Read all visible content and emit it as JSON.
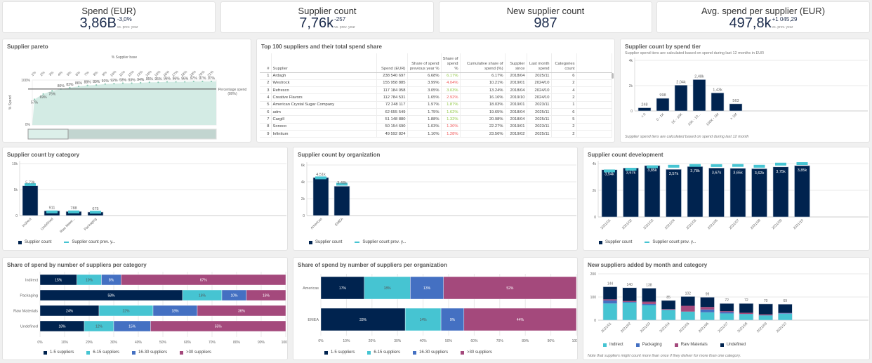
{
  "kpis": [
    {
      "title": "Spend (EUR)",
      "value": "3,86B",
      "delta": "-3,0%",
      "sub": "vs. prev. year"
    },
    {
      "title": "Supplier count",
      "value": "7,76k",
      "delta": "-257",
      "sub": "vs. prev. year"
    },
    {
      "title": "New supplier count",
      "value": "987",
      "delta": "",
      "sub": ""
    },
    {
      "title": "Avg. spend per supplier (EUR)",
      "value": "497,8k",
      "delta": "+1 045,29",
      "sub": "vs. prev. year"
    }
  ],
  "pareto": {
    "title": "Supplier pareto",
    "xtitle": "% Supplier base",
    "ytitle": "% Spend",
    "ref_label": "Percentage spend",
    "ref_value": "(80%)",
    "ref": 80,
    "x": [
      "1%",
      "2%",
      "3%",
      "4%",
      "5%",
      "6%",
      "7%",
      "8%",
      "9%",
      "10%",
      "11%",
      "12%",
      "13%",
      "14%",
      "15%",
      "16%",
      "17%",
      "18%",
      "19%",
      "20%",
      "21%"
    ],
    "y": [
      57,
      69,
      76,
      80,
      83,
      86,
      88,
      89,
      91,
      92,
      93,
      93,
      94,
      95,
      95,
      96,
      96,
      96,
      97,
      97,
      97
    ],
    "yticks": [
      "0%",
      "100%"
    ],
    "colors": {
      "fill": "#d3ebe4",
      "point": "#8cc8b4"
    }
  },
  "table": {
    "title": "Top 100 suppliers and their total spend share",
    "columns": [
      "#",
      "Supplier",
      "Spend (EUR)",
      "Share of spend previous year %",
      "Share of spend %",
      "Cumulative share of spend (%)",
      "Supplier since",
      "Last month spend",
      "Categories count"
    ],
    "rows": [
      [
        "1",
        "Ardagh",
        "238 540 697",
        "6.68%",
        "6.17%",
        "6.17%",
        "2018/04",
        "2025/11",
        "6"
      ],
      [
        "2",
        "Westrock",
        "155 958 885",
        "3.99%",
        "4.04%",
        "10.21%",
        "2019/01",
        "2024/10",
        "2"
      ],
      [
        "3",
        "Refresco",
        "117 184 058",
        "3.05%",
        "3.03%",
        "13.24%",
        "2018/04",
        "2024/10",
        "4"
      ],
      [
        "4",
        "Creative Flavors",
        "112 784 531",
        "1.65%",
        "2.92%",
        "16.16%",
        "2019/10",
        "2024/10",
        "2"
      ],
      [
        "5",
        "American Crystal Sugar Company",
        "72 248 117",
        "1.97%",
        "1.87%",
        "18.03%",
        "2019/01",
        "2023/11",
        "1"
      ],
      [
        "6",
        "adm",
        "62 655 549",
        "1.75%",
        "1.62%",
        "19.65%",
        "2018/04",
        "2025/11",
        "6"
      ],
      [
        "7",
        "Cargill",
        "51 148 880",
        "1.88%",
        "1.32%",
        "20.98%",
        "2018/04",
        "2025/11",
        "5"
      ],
      [
        "8",
        "Sonoco",
        "50 154 690",
        "1.03%",
        "1.30%",
        "22.27%",
        "2019/01",
        "2023/11",
        "2"
      ],
      [
        "9",
        "Infinitum",
        "49 592 824",
        "1.10%",
        "1.28%",
        "23.56%",
        "2019/02",
        "2025/11",
        "2"
      ]
    ],
    "share_status": [
      "up",
      "down",
      "up",
      "down",
      "up",
      "up",
      "up",
      "down",
      "down"
    ],
    "colors": {
      "up": "#8dc63f",
      "down": "#f0595a"
    }
  },
  "chart_data": [
    {
      "id": "tier",
      "type": "bar",
      "title": "Supplier count by spend tier",
      "subtitle": "Supplier spend tiers are calculated based on spend during last 12 months in EUR",
      "footnote": "Supplier spend tiers are calculated based on spend during last 12 month",
      "categories": [
        "< 0",
        "0 - 1K",
        "1K - 10K",
        "10K - 10...",
        "100K - 1M",
        "> 1M"
      ],
      "values": [
        248,
        998,
        2040,
        2480,
        1430,
        563
      ],
      "labels": [
        "248",
        "998",
        "2,04k",
        "2,48k",
        "1,43k",
        "563"
      ],
      "ylim": [
        0,
        4000
      ],
      "yticks": [
        "0",
        "2k",
        "4k"
      ]
    },
    {
      "id": "cat",
      "type": "bar",
      "title": "Supplier count by category",
      "categories": [
        "Indirect",
        "Undefined",
        "Raw Mater...",
        "Packaging"
      ],
      "series": [
        {
          "name": "Supplier count",
          "values": [
            5730,
            911,
            788,
            675
          ]
        },
        {
          "name": "Supplier count prev. y...",
          "values": [
            5950,
            700,
            700,
            640
          ]
        }
      ],
      "labels": [
        "5,73k",
        "911",
        "788",
        "675"
      ],
      "ylim": [
        0,
        10000
      ],
      "yticks": [
        "0",
        "5k",
        "10k"
      ]
    },
    {
      "id": "org",
      "type": "bar",
      "title": "Supplier count by organization",
      "categories": [
        "Americas",
        "EMEA"
      ],
      "series": [
        {
          "name": "Supplier count",
          "values": [
            4510,
            3480
          ]
        },
        {
          "name": "Supplier count prev. y...",
          "values": [
            4470,
            3720
          ]
        }
      ],
      "labels": [
        "4,51k",
        "3,48k"
      ],
      "ylim": [
        0,
        6000
      ],
      "yticks": [
        "0",
        "2k",
        "4k",
        "6k"
      ]
    },
    {
      "id": "dev",
      "type": "bar",
      "title": "Supplier count development",
      "categories": [
        "2021/01",
        "2021/02",
        "2021/03",
        "2021/04",
        "2021/05",
        "2021/06",
        "2021/07",
        "2021/08",
        "2021/09",
        "2021/10"
      ],
      "series": [
        {
          "name": "Supplier count",
          "values": [
            3540,
            3670,
            3850,
            3570,
            3780,
            3670,
            3650,
            3620,
            3750,
            3850
          ]
        },
        {
          "name": "Supplier count prev. y...",
          "values": [
            3450,
            3580,
            3760,
            3800,
            3860,
            3850,
            3860,
            3800,
            3960,
            4000
          ]
        }
      ],
      "labels": [
        "3,54k",
        "3,67k",
        "3,85k",
        "3,57k",
        "3,78k",
        "3,67k",
        "3,65k",
        "3,62k",
        "3,75k",
        "3,85k"
      ],
      "ylim": [
        0,
        4000
      ],
      "yticks": [
        "0",
        "2k",
        "4k"
      ]
    },
    {
      "id": "sharecat",
      "type": "bar-horizontal-stacked",
      "title": "Share of spend by number of suppliers per category",
      "categories": [
        "Indirect",
        "Packaging",
        "Raw Materials",
        "Undefined"
      ],
      "series": [
        {
          "name": "1-5 suppliers",
          "values": [
            15,
            58,
            24,
            18
          ]
        },
        {
          "name": "6-15 suppliers",
          "values": [
            10,
            16,
            22,
            12
          ]
        },
        {
          "name": "16-30 suppliers",
          "values": [
            8,
            10,
            18,
            15
          ]
        },
        {
          "name": ">30 suppliers",
          "values": [
            67,
            16,
            36,
            55
          ]
        }
      ],
      "xlim": [
        0,
        100
      ],
      "xticks": [
        "0%",
        "10%",
        "20%",
        "30%",
        "40%",
        "50%",
        "60%",
        "70%",
        "80%",
        "90%",
        "100%"
      ]
    },
    {
      "id": "shareorg",
      "type": "bar-horizontal-stacked",
      "title": "Share of spend by number of suppliers per organization",
      "categories": [
        "Americas",
        "EMEA"
      ],
      "series": [
        {
          "name": "1-5 suppliers",
          "values": [
            17,
            33
          ]
        },
        {
          "name": "6-15 suppliers",
          "values": [
            18,
            14
          ]
        },
        {
          "name": "16-30 suppliers",
          "values": [
            13,
            9
          ]
        },
        {
          "name": ">30 suppliers",
          "values": [
            52,
            44
          ]
        }
      ],
      "xlim": [
        0,
        100
      ],
      "xticks": [
        "0%",
        "10%",
        "20%",
        "30%",
        "40%",
        "50%",
        "60%",
        "70%",
        "80%",
        "90%",
        "100%"
      ]
    },
    {
      "id": "newsup",
      "type": "bar-stacked",
      "title": "New suppliers added by month and category",
      "footnote": "Note that suppliers might count more than once if they deliver for more than one category.",
      "categories": [
        "2021/01",
        "2021/02",
        "2021/03",
        "2021/04",
        "2021/05",
        "2021/06",
        "2021/07",
        "2021/08",
        "2021/09",
        "2021/10"
      ],
      "series": [
        {
          "name": "Indirect",
          "values": [
            72,
            76,
            65,
            44,
            37,
            34,
            29,
            26,
            20,
            28
          ]
        },
        {
          "name": "Packaging",
          "values": [
            13,
            3,
            5,
            1,
            0,
            12,
            6,
            1,
            1,
            2
          ]
        },
        {
          "name": "Raw Materials",
          "values": [
            5,
            4,
            10,
            3,
            25,
            11,
            4,
            5,
            4,
            1
          ]
        },
        {
          "name": "Undefined",
          "values": [
            54,
            57,
            58,
            37,
            40,
            42,
            33,
            40,
            45,
            38
          ]
        }
      ],
      "totals": [
        "144",
        "140",
        "138",
        "85",
        "102",
        "99",
        "72",
        "72",
        "70",
        "69"
      ],
      "ylim": [
        0,
        200
      ],
      "yticks": [
        "0",
        "100",
        "200"
      ]
    }
  ],
  "colors": {
    "navy": "#00234f",
    "teal": "#46c4d2",
    "blue": "#4470c2",
    "magenta": "#a4497c",
    "grid": "#e8e8e8"
  }
}
